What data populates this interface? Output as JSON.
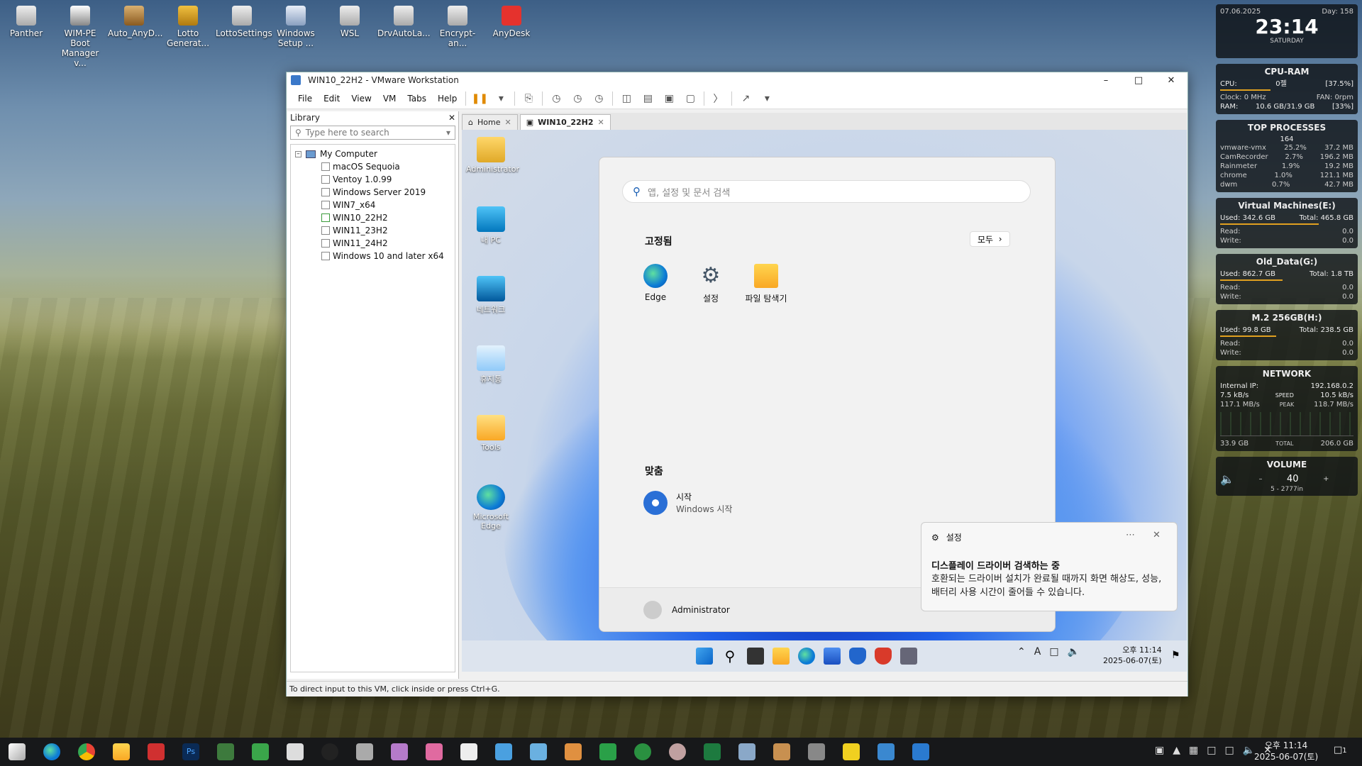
{
  "desktop": {
    "icons": [
      {
        "label": "Panther"
      },
      {
        "label": "WIM-PE Boot Manager v..."
      },
      {
        "label": "Auto_AnyD..."
      },
      {
        "label": "Lotto Generat..."
      },
      {
        "label": "LottoSettings"
      },
      {
        "label": "Windows Setup ..."
      },
      {
        "label": "WSL"
      },
      {
        "label": "DrvAutoLa..."
      },
      {
        "label": "Encrypt-an..."
      },
      {
        "label": "AnyDesk"
      }
    ]
  },
  "vmware": {
    "title": "WIN10_22H2 - VMware Workstation",
    "menu": [
      "File",
      "Edit",
      "View",
      "VM",
      "Tabs",
      "Help"
    ],
    "library": {
      "title": "Library",
      "search_placeholder": "Type here to search",
      "root": "My Computer",
      "vms": [
        "macOS Sequoia",
        "Ventoy 1.0.99",
        "Windows Server 2019",
        "WIN7_x64",
        "WIN10_22H2",
        "WIN11_23H2",
        "WIN11_24H2",
        "Windows 10 and later x64"
      ]
    },
    "tabs": [
      {
        "label": "Home"
      },
      {
        "label": "WIN10_22H2"
      }
    ],
    "status": "To direct input to this VM, click inside or press Ctrl+G."
  },
  "guest": {
    "desktop_icons": [
      {
        "label": "Administrator"
      },
      {
        "label": "내 PC"
      },
      {
        "label": "네트워크"
      },
      {
        "label": "휴지통"
      },
      {
        "label": "Tools"
      },
      {
        "label": "Microsoft Edge"
      }
    ],
    "start": {
      "search_placeholder": "앱, 설정 및 문서 검색",
      "pinned_title": "고정됨",
      "all_label": "모두",
      "pinned": [
        {
          "label": "Edge"
        },
        {
          "label": "설정"
        },
        {
          "label": "파일 탐색기"
        }
      ],
      "rec_title": "맞춤",
      "rec_item": {
        "title": "시작",
        "sub": "Windows 시작"
      },
      "user": "Administrator"
    },
    "toast": {
      "app": "설정",
      "title": "디스플레이 드라이버 검색하는 중",
      "body": "호환되는 드라이버 설치가 완료될 때까지 화면 해상도, 성능, 배터리 사용 시간이 줄어들 수 있습니다."
    },
    "clock": {
      "time": "오후 11:14",
      "date": "2025-06-07(토)"
    }
  },
  "widgets": {
    "clock": {
      "date": "07.06.2025",
      "day": "Day: 158",
      "time": "23:14",
      "weekday": "SATURDAY"
    },
    "cpuram": {
      "title": "CPU-RAM",
      "cpu_label": "CPU:",
      "cpu_val": "0젤",
      "cpu_pct": "[37.5%]",
      "clock_label": "Clock: 0 MHz",
      "fan_label": "FAN: 0rpm",
      "ram_label": "RAM:",
      "ram_val": "10.6 GB/31.9 GB",
      "ram_pct": "[33%]"
    },
    "top": {
      "title": "TOP PROCESSES",
      "count": "164",
      "rows": [
        {
          "name": "vmware-vmx",
          "cpu": "25.2%",
          "mem": "37.2 MB"
        },
        {
          "name": "CamRecorder",
          "cpu": "2.7%",
          "mem": "196.2 MB"
        },
        {
          "name": "Rainmeter",
          "cpu": "1.9%",
          "mem": "19.2 MB"
        },
        {
          "name": "chrome",
          "cpu": "1.0%",
          "mem": "121.1 MB"
        },
        {
          "name": "dwm",
          "cpu": "0.7%",
          "mem": "42.7 MB"
        }
      ]
    },
    "disks": [
      {
        "title": "Virtual Machines(E:)",
        "used": "Used: 342.6 GB",
        "total": "Total: 465.8 GB",
        "read": "Read:",
        "write": "Write:",
        "rv": "0.0",
        "wv": "0.0"
      },
      {
        "title": "Old_Data(G:)",
        "used": "Used: 862.7 GB",
        "total": "Total: 1.8 TB",
        "read": "Read:",
        "write": "Write:",
        "rv": "0.0",
        "wv": "0.0"
      },
      {
        "title": "M.2 256GB(H:)",
        "used": "Used: 99.8 GB",
        "total": "Total: 238.5 GB",
        "read": "Read:",
        "write": "Write:",
        "rv": "0.0",
        "wv": "0.0"
      }
    ],
    "network": {
      "title": "NETWORK",
      "ip_label": "Internal IP:",
      "ip": "192.168.0.2",
      "up": "7.5 kB/s",
      "speed": "SPEED",
      "down": "10.5 kB/s",
      "up2": "117.1 MB/s",
      "peak": "PEAK",
      "down2": "118.7 MB/s",
      "tot_up": "33.9 GB",
      "total": "TOTAL",
      "tot_down": "206.0 GB"
    },
    "volume": {
      "title": "VOLUME",
      "value": "40",
      "dev": "5 - 2777in"
    }
  },
  "host": {
    "clock": {
      "time": "오후 11:14",
      "date": "2025-06-07(토)"
    },
    "notif": "1"
  }
}
